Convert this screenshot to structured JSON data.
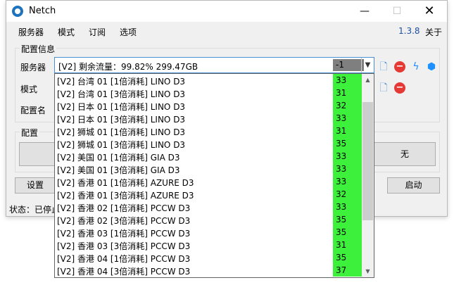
{
  "window": {
    "title": "Netch",
    "minimize": "—",
    "maximize": "☐",
    "close": "✕"
  },
  "menu": {
    "items": [
      "服务器",
      "模式",
      "订阅",
      "选项"
    ],
    "version": "1.3.8",
    "about": "关于"
  },
  "config_group": {
    "label": "配置信息",
    "server_label": "服务器",
    "mode_label": "模式",
    "profile_label": "配置名"
  },
  "combo": {
    "text": "[V2] 剩余流量：99.82%  299.47GB",
    "badge": "-1",
    "arrow": "▼"
  },
  "profile_group": {
    "label": "配置"
  },
  "buttons": {
    "settings": "设置",
    "none": "无",
    "start": "启动"
  },
  "status": {
    "text": "状态：已停止"
  },
  "icons": {
    "doc": "🗋",
    "minus": "−",
    "bolt": "ϟ",
    "cube": "⬢"
  },
  "dropdown": {
    "items": [
      {
        "text": "[V2] 台湾 01 [1倍消耗] LINO D3",
        "latency": "33"
      },
      {
        "text": "[V2] 台湾 01 [3倍消耗] LINO D3",
        "latency": "31"
      },
      {
        "text": "[V2] 日本 01 [1倍消耗] LINO D3",
        "latency": "32"
      },
      {
        "text": "[V2] 日本 01 [3倍消耗] LINO D3",
        "latency": "33"
      },
      {
        "text": "[V2] 狮城 01 [1倍消耗] LINO D3",
        "latency": "31"
      },
      {
        "text": "[V2] 狮城 01 [3倍消耗] LINO D3",
        "latency": "35"
      },
      {
        "text": "[V2] 美国 01 [1倍消耗] GIA D3",
        "latency": "33"
      },
      {
        "text": "[V2] 美国 01 [3倍消耗] GIA D3",
        "latency": "33"
      },
      {
        "text": "[V2] 香港 01 [1倍消耗] AZURE D3",
        "latency": "33"
      },
      {
        "text": "[V2] 香港 01 [3倍消耗] AZURE D3",
        "latency": "32"
      },
      {
        "text": "[V2] 香港 02 [1倍消耗] PCCW D3",
        "latency": "33"
      },
      {
        "text": "[V2] 香港 02 [3倍消耗] PCCW D3",
        "latency": "35"
      },
      {
        "text": "[V2] 香港 03 [1倍消耗] PCCW D3",
        "latency": "35"
      },
      {
        "text": "[V2] 香港 03 [3倍消耗] PCCW D3",
        "latency": "31"
      },
      {
        "text": "[V2] 香港 04 [1倍消耗] PCCW D3",
        "latency": "35"
      },
      {
        "text": "[V2] 香港 04 [3倍消耗] PCCW D3",
        "latency": "37"
      }
    ]
  },
  "colors": {
    "latency_bg": "#3cf03c",
    "accent": "#1e50a0"
  }
}
